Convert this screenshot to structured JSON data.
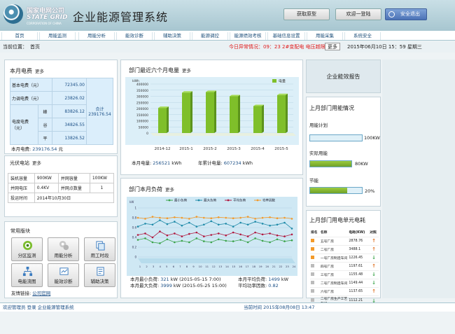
{
  "header": {
    "company_cn": "国家电网公司",
    "company_en": "STATE GRID",
    "company_en_sub": "CORPORATION OF CHINA",
    "system_title": "企业能源管理系统",
    "btn_prototype": "获取原型",
    "btn_welcome": "欢迎一登陆",
    "btn_logout": "安全退出"
  },
  "nav": [
    "首页",
    "用能监测",
    "用能分析",
    "能效诊断",
    "辅助决策",
    "能源调控",
    "能源绩效考核",
    "基础信息设置",
    "用能采集",
    "系统安全"
  ],
  "status": {
    "location_label": "当前位置：",
    "location": "首页",
    "alarm": "今日异常情况：09：23 2#变配电 电压越限",
    "more": "更多",
    "date": "2015年06月10日 15：59 星期三"
  },
  "monthly_cost": {
    "title": "本月电费",
    "more": "更多",
    "basic_label": "基本电费（元）",
    "basic_value": "72345.00",
    "power_factor_label": "力调电费（元）",
    "power_factor_value": "23826.02",
    "energy_label": "电度电费（元）",
    "peak_label": "峰",
    "peak_value": "83826.12",
    "flat_label": "谷",
    "flat_value": "34826.55",
    "valley_label": "平",
    "valley_value": "13826.52",
    "total_label": "合计",
    "total_value": "239176.54",
    "summary_label": "本月电费:",
    "summary_value": "239176.54",
    "summary_unit": "元"
  },
  "pv": {
    "title": "光伏电站",
    "more": "更多",
    "rows": [
      [
        "装机容量",
        "900KW",
        "并网容量",
        "100KW"
      ],
      [
        "并网电压",
        "0.4KV",
        "并网点数量",
        "1"
      ]
    ],
    "date_label": "投运时间",
    "date_value": "2014年10月30日"
  },
  "common": {
    "title": "常用版块",
    "buttons": [
      "分区监测",
      "用能分析",
      "用工时段",
      "电能流图",
      "能效诊断",
      "辅助决策"
    ],
    "links_label": "友情链接:",
    "link": "公司官网"
  },
  "chart_data": [
    {
      "type": "bar",
      "title": "部门最近六个月电量",
      "ylabel": "kWh",
      "legend": "电量",
      "categories": [
        "2014-12",
        "2015-1",
        "2015-2",
        "2015-3",
        "2015-4",
        "2015-5"
      ],
      "values": [
        205000,
        330000,
        335000,
        300000,
        220000,
        310000
      ],
      "ylim": [
        0,
        400000
      ],
      "yticks": [
        0,
        50000,
        100000,
        150000,
        200000,
        250000,
        300000,
        350000,
        400000
      ],
      "ytick_labels": [
        "0",
        "50000",
        "100000",
        "150000",
        "200000",
        "250000",
        "300000",
        "350000",
        "400000"
      ],
      "grid": true,
      "legend_position": "top-right"
    },
    {
      "type": "line",
      "title": "部门本月负荷",
      "ylabel": "kW",
      "series": [
        {
          "name": "最小负荷",
          "color": "#3aa34a",
          "values": [
            0.35,
            0.38,
            0.3,
            0.28,
            0.36,
            0.3,
            0.33,
            0.3,
            0.38,
            0.32,
            0.3,
            0.36,
            0.33,
            0.32,
            0.35,
            0.3,
            0.38,
            0.33,
            0.3,
            0.36,
            0.32,
            0.34
          ]
        },
        {
          "name": "最大负荷",
          "color": "#1f8aa8",
          "values": [
            0.62,
            0.68,
            0.66,
            0.75,
            0.67,
            0.72,
            0.64,
            0.7,
            0.62,
            0.66,
            0.73,
            0.66,
            0.68,
            0.62,
            0.7,
            0.66,
            0.72,
            0.68,
            0.64,
            0.66,
            0.7,
            0.58
          ]
        },
        {
          "name": "平均负荷",
          "color": "#b0183f",
          "values": [
            0.45,
            0.48,
            0.4,
            0.52,
            0.44,
            0.48,
            0.42,
            0.47,
            0.5,
            0.42,
            0.45,
            0.48,
            0.44,
            0.5,
            0.46,
            0.42,
            0.5,
            0.46,
            0.48,
            0.44,
            0.42,
            0.46
          ]
        },
        {
          "name": "功率因数",
          "color": "#f39a2a",
          "values": [
            0.8,
            0.78,
            0.82,
            0.8,
            0.79,
            0.81,
            0.8,
            0.78,
            0.82,
            0.8,
            0.79,
            0.81,
            0.8,
            0.79,
            0.8,
            0.82,
            0.78,
            0.8,
            0.81,
            0.79,
            0.8,
            0.78
          ]
        }
      ],
      "categories": [
        "1",
        "2",
        "3",
        "4",
        "5",
        "6",
        "7",
        "8",
        "9",
        "10",
        "11",
        "12",
        "13",
        "14",
        "15",
        "16",
        "17",
        "18",
        "19",
        "20",
        "21",
        "22",
        "23",
        "24"
      ],
      "ylim": [
        0,
        1
      ],
      "yticks": [
        0,
        0.2,
        0.4,
        0.6,
        0.8,
        1
      ],
      "ytick_labels": [
        "0",
        "0.2",
        "0.4",
        "0.6",
        "0.8",
        "1"
      ],
      "legend_position": "top"
    }
  ],
  "energy_chart_footer": {
    "this_month_label": "本月电量:",
    "this_month_value": "256521",
    "this_month_unit": "kWh",
    "year_label": "年累计电量:",
    "year_value": "607234",
    "year_unit": "kWh"
  },
  "load_footer": {
    "min_label": "本月最小负荷:",
    "min_value": "321",
    "min_unit": "kW",
    "min_time": "(2015-05-15 7:00)",
    "max_label": "本月最大负荷:",
    "max_value": "3999",
    "max_unit": "kW",
    "max_time": "(2015-05-25 15:00)",
    "avg_label": "本月平均负荷:",
    "avg_value": "1499",
    "avg_unit": "kW",
    "pf_label": "平均功率因数:",
    "pf_value": "0.82"
  },
  "report": {
    "title": "企业能效报告"
  },
  "usage": {
    "title": "上月部门用能情况",
    "items": [
      {
        "label": "用能计划",
        "value_text": "100KW",
        "fill": 0.0
      },
      {
        "label": "实际用能",
        "value_text": "80KW",
        "fill": 1.0
      },
      {
        "label": "节能",
        "value_text": "20%",
        "fill": 0.72
      }
    ]
  },
  "unit_cost": {
    "title": "上月部门用电单元电耗",
    "headers": [
      "排名",
      "名称",
      "电耗(KW)",
      "对照"
    ],
    "rows": [
      {
        "name": "五号厂房",
        "value": "2878.76",
        "trend": "up"
      },
      {
        "name": "二号厂房",
        "value": "3488.1",
        "trend": "up"
      },
      {
        "name": "一号厂房制造车间",
        "value": "1226.45",
        "trend": "down"
      },
      {
        "name": "四号厂房",
        "value": "1197.61",
        "trend": "up"
      },
      {
        "name": "三号厂房",
        "value": "1155.48",
        "trend": "down"
      },
      {
        "name": "二号厂房制造车间",
        "value": "1149.44",
        "trend": "down"
      },
      {
        "name": "六号厂房",
        "value": "1137.65",
        "trend": "up"
      },
      {
        "name": "二号厂房生产工艺车间",
        "value": "1112.21",
        "trend": "down"
      }
    ]
  },
  "footer": {
    "left": "欢迎管理员 登录 企业能源管理系统",
    "time": "当前时间 2015年08月08日 13:47"
  },
  "colors": {
    "accent": "#1b4f86",
    "alarm": "#e01a1a",
    "bar_green": "#7fbf2a",
    "header_bg": "#b4d1da"
  }
}
